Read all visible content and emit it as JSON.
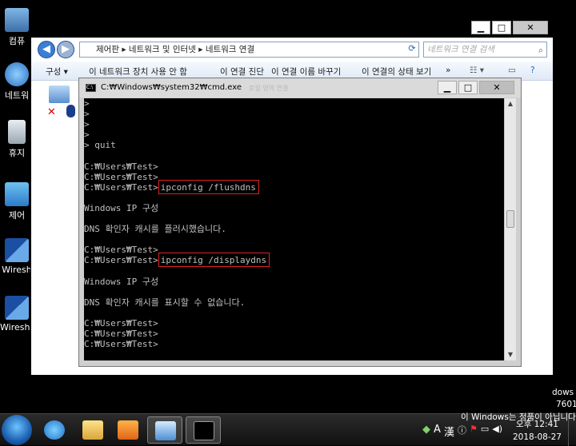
{
  "desktop": {
    "icons": [
      {
        "label": "컴퓨"
      },
      {
        "label": "네트워"
      },
      {
        "label": "휴지"
      },
      {
        "label": "제어"
      },
      {
        "label": "Wiresh"
      },
      {
        "label": "Wiresha"
      }
    ]
  },
  "explorer": {
    "address": {
      "path": "제어판  ▸  네트워크 및 인터넷  ▸  네트워크 연결",
      "search_placeholder": "네트워크 연결 검색"
    },
    "toolbar": {
      "organize": "구성 ▾",
      "items": [
        "이 네트워크 장치 사용 안 함",
        "이 연결 진단",
        "이 연결 이름 바꾸기",
        "이 연결의 상태 보기"
      ],
      "more": "»"
    },
    "window_buttons": {
      "minimize": "▁",
      "maximize": "□",
      "close": "✕"
    }
  },
  "cmd": {
    "title": "C:₩Windows₩system32₩cmd.exe",
    "title_ghost": "로컬 영역 연결",
    "window_buttons": {
      "minimize": "▁",
      "maximize": "□",
      "close": "✕"
    },
    "lines": [
      ">",
      ">",
      ">",
      ">",
      "> quit",
      "",
      "C:₩Users₩Test>",
      "C:₩Users₩Test>",
      "C:₩Users₩Test>",
      "",
      "Windows IP 구성",
      "",
      "DNS 확인자 캐시를 플러시했습니다.",
      "",
      "C:₩Users₩Test>",
      "C:₩Users₩Test>",
      "",
      "Windows IP 구성",
      "",
      "DNS 확인자 캐시를 표시할 수 없습니다.",
      "",
      "C:₩Users₩Test>",
      "C:₩Users₩Test>",
      "C:₩Users₩Test>"
    ],
    "commands": {
      "flush": "ipconfig /flushdns",
      "display": "ipconfig /displaydns"
    }
  },
  "watermark": {
    "line1": "dows 7",
    "line2": "7601",
    "line3": "이 Windows는 정품이 아닙니다."
  },
  "taskbar": {
    "ime_lang": "A",
    "ime_hanja": "漢",
    "time": "오후 12:41",
    "date": "2018-08-27"
  },
  "colors": {
    "highlight_border": "#e02222",
    "console_bg": "#000000",
    "console_fg": "#c0c0c0"
  }
}
